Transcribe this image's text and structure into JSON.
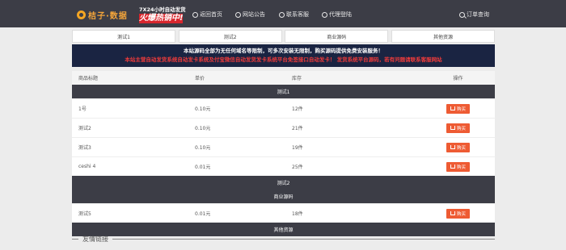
{
  "header": {
    "brand": "桔子·数据",
    "promo_small": "7X24小时自动发货",
    "promo_big": "火爆热销中!",
    "nav": [
      "返回首页",
      "网站公告",
      "联系客服",
      "代理登陆"
    ],
    "order_search": "订单查询"
  },
  "tabs": [
    "测试1",
    "测试2",
    "商业源码",
    "其他资源"
  ],
  "notice": {
    "line1": "本站源码全部为无任何域名等限制，可多次安装无限制，购买源码提供免费安装服务！",
    "line2": "本站主营自动发货系统自动发卡系统及付宝微信自动发货发卡系统平台免签接口自动发卡！ 发货系统平台源码，若有问题请联系客服网站"
  },
  "table": {
    "headers": [
      "商品标题",
      "单价",
      "库存",
      "操作"
    ],
    "buy_label": "购买",
    "groups": [
      {
        "name": "测试1",
        "rows": [
          {
            "title": "1号",
            "price": "0.10元",
            "stock": "12件"
          },
          {
            "title": "测试2",
            "price": "0.10元",
            "stock": "21件"
          },
          {
            "title": "测试3",
            "price": "0.10元",
            "stock": "19件"
          },
          {
            "title": "ceshi 4",
            "price": "0.01元",
            "stock": "25件"
          }
        ]
      },
      {
        "name": "测试2",
        "rows": []
      },
      {
        "name": "商业源码",
        "rows": [
          {
            "title": "测试5",
            "price": "0.01元",
            "stock": "18件"
          }
        ]
      },
      {
        "name": "其他资源",
        "rows": []
      }
    ]
  },
  "friends": {
    "title": "友情链接"
  },
  "colors": {
    "header_bg": "#3c3d46",
    "buy_button": "#ee5b33",
    "notice_bg": "#1a2442",
    "notice_red": "#ee3b3b",
    "brand": "#f2a43a"
  }
}
